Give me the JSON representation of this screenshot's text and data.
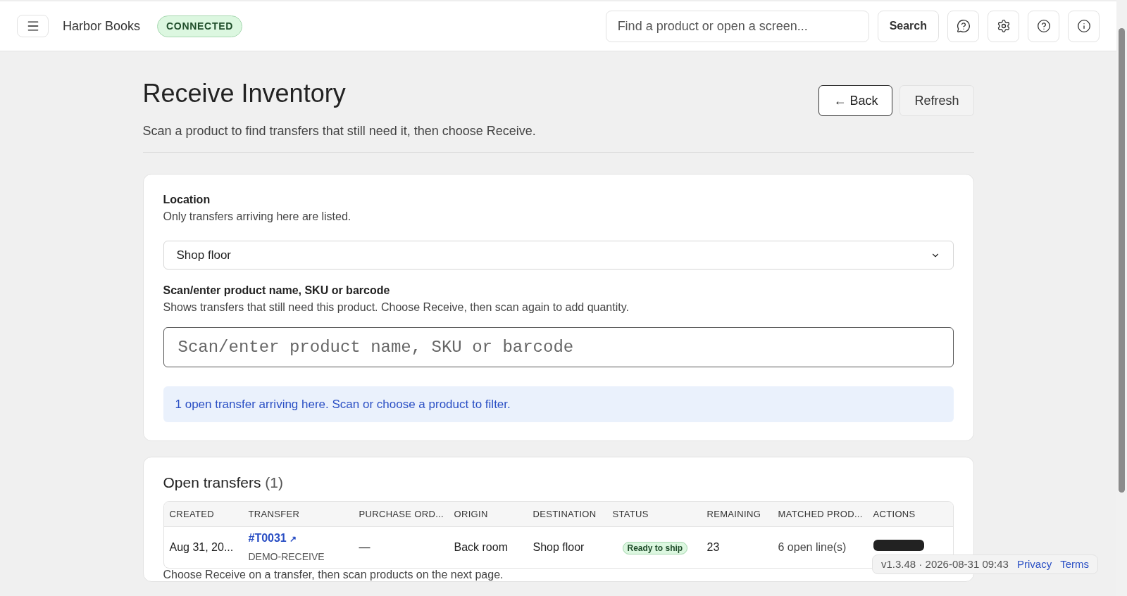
{
  "header": {
    "brand": "Harbor Books",
    "status_badge": "CONNECTED",
    "search": {
      "placeholder": "Find a product or open a screen..."
    },
    "search_button": "Search"
  },
  "page": {
    "title": "Receive Inventory",
    "subtitle": "Scan a product to find transfers that still need it, then choose Receive.",
    "buttons": [
      {
        "label": "← Back",
        "kind": "outline"
      },
      {
        "label": "Refresh",
        "kind": "plain"
      }
    ]
  },
  "location": {
    "label": "Location",
    "hint": "Only transfers arriving here are listed.",
    "value": "Shop floor"
  },
  "scan": {
    "label": "Scan/enter product name, SKU or barcode",
    "hint": "Shows transfers that still need this product. Choose Receive, then scan again to add quantity.",
    "placeholder": "Scan/enter product name, SKU or barcode"
  },
  "notice": "1 open transfer arriving here. Scan or choose a product to filter.",
  "transfers": {
    "title": "Open transfers",
    "count": "(1)",
    "columns": [
      "CREATED",
      "TRANSFER",
      "PURCHASE ORD...",
      "ORIGIN",
      "DESTINATION",
      "STATUS",
      "REMAINING",
      "MATCHED PROD...",
      "ACTIONS"
    ],
    "rows": [
      {
        "created": "Aug 31, 20...",
        "transfer": "#T0031",
        "transfer_link_icon": "↗",
        "reference": "DEMO-RECEIVE",
        "purchase_order": "—",
        "origin": "Back room",
        "destination": "Shop floor",
        "status": "Ready to ship",
        "remaining": "23",
        "matched": "6 open line(s)"
      }
    ],
    "footnote": "Choose Receive on a transfer, then scan products on the next page."
  },
  "footer": {
    "version": "v1.3.48 · 2026-08-31 09:43",
    "links": [
      "Privacy",
      "Terms"
    ]
  }
}
